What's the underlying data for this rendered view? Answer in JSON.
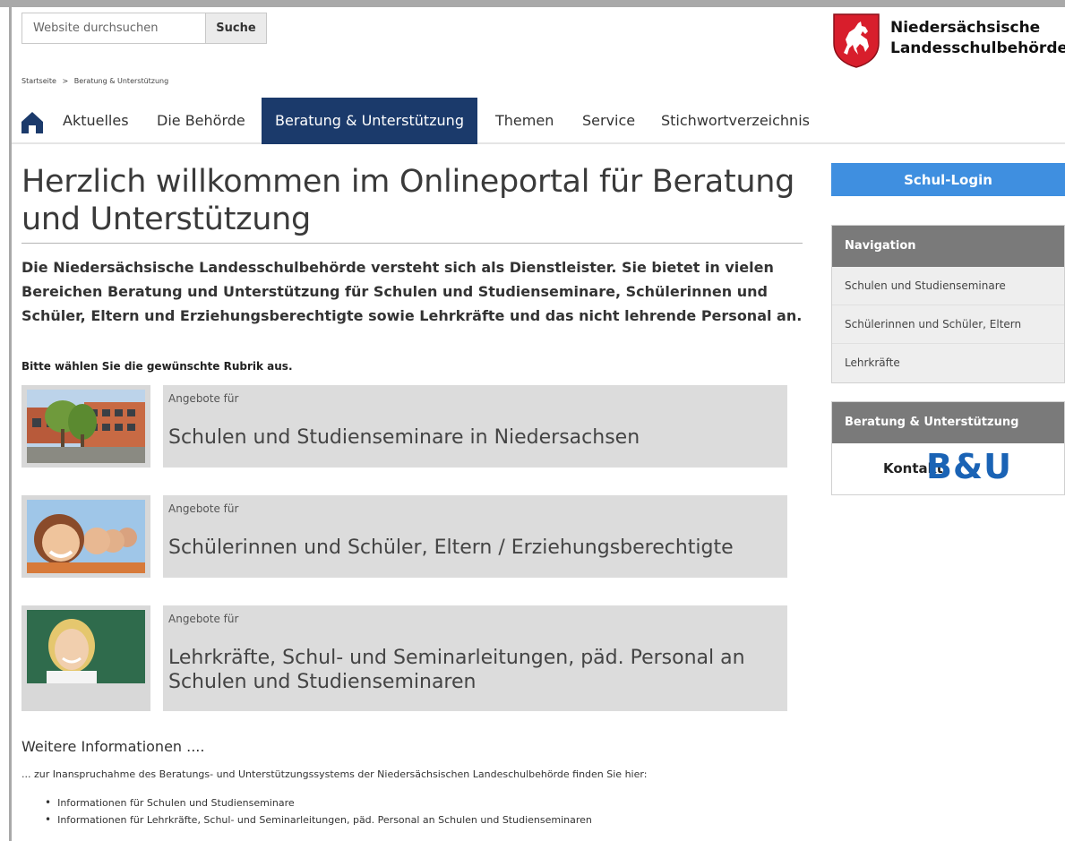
{
  "search": {
    "placeholder": "Website durchsuchen",
    "button_label": "Suche"
  },
  "logo": {
    "line1": "Niedersächsische",
    "line2": "Landesschulbehörde"
  },
  "breadcrumb": [
    "Startseite",
    ">",
    "Beratung & Unterstützung"
  ],
  "nav": {
    "items": [
      {
        "label": "Aktuelles"
      },
      {
        "label": "Die Behörde"
      },
      {
        "label": "Beratung & Unterstützung",
        "active": true
      },
      {
        "label": "Themen"
      },
      {
        "label": "Service"
      },
      {
        "label": "Stichwortverzeichnis"
      }
    ]
  },
  "main": {
    "title": "Herzlich willkommen im Onlineportal für Beratung und Unterstützung",
    "intro": "Die Niedersächsische Landesschulbehörde versteht sich als Dienstleister. Sie bietet in vielen Bereichen Beratung und Unterstützung für Schulen und Studienseminare, Schülerinnen und Schüler, Eltern und Erziehungsberechtigte sowie Lehrkräfte und das nicht lehrende Personal an.",
    "prompt": "Bitte wählen Sie die gewünschte Rubrik aus.",
    "tiles": [
      {
        "kicker": "Angebote für",
        "title": "Schulen und Studienseminare in Niedersachsen"
      },
      {
        "kicker": "Angebote für",
        "title": "Schülerinnen und  Schüler, Eltern / Erziehungsberechtigte"
      },
      {
        "kicker": "Angebote für",
        "title": "Lehrkräfte, Schul- und Seminarleitungen, päd. Personal an Schulen und Studienseminaren"
      }
    ],
    "more": {
      "heading": "Weitere Informationen ....",
      "text": "... zur Inanspruchahme des Beratungs- und Unterstützungssystems der Niedersächsischen Landeschulbehörde finden Sie hier:",
      "links": [
        "Informationen für Schulen und Studienseminare",
        "Informationen für Lehrkräfte, Schul- und Seminarleitungen, päd. Personal an Schulen und Studienseminaren"
      ]
    }
  },
  "sidebar": {
    "login_label": "Schul-Login",
    "navigation": {
      "heading": "Navigation",
      "items": [
        "Schulen und Studienseminare",
        "Schülerinnen und Schüler, Eltern",
        "Lehrkräfte"
      ]
    },
    "bu_box": {
      "heading": "Beratung & Unterstützung",
      "kontakt": "Kontakt",
      "logo_text": "B&U"
    }
  },
  "colors": {
    "nav_active": "#1b3a6b",
    "login_button": "#3f8fe0",
    "side_heading": "#7a7a7a",
    "bu_logo": "#1a63b5",
    "crest_red": "#d81e2c"
  }
}
